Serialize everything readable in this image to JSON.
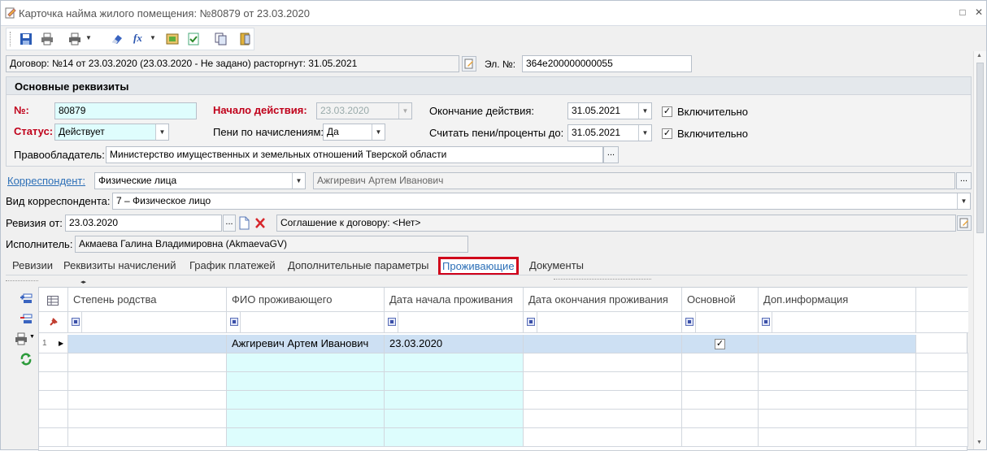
{
  "window": {
    "title": "Карточка найма жилого помещения: №80879 от 23.03.2020",
    "pin": "□",
    "close": "✕"
  },
  "toolbar": {
    "icons": [
      "save-icon",
      "print-icon",
      "print-dropdown-icon",
      "eraser-icon",
      "formula-icon",
      "book-green-icon",
      "doc-check-icon",
      "copy-icon",
      "exit-icon"
    ]
  },
  "contract": {
    "text": "Договор: №14 от 23.03.2020 (23.03.2020 -  Не задано) расторгнут: 31.05.2021",
    "el_label": "Эл. №:",
    "el_value": "364e200000000055"
  },
  "main": {
    "header": "Основные реквизиты",
    "num_label": "№:",
    "num_value": "80879",
    "start_label": "Начало действия:",
    "start_value": "23.03.2020",
    "end_label": "Окончание действия:",
    "end_value": "31.05.2021",
    "end_incl": "Включительно",
    "status_label": "Статус:",
    "status_value": "Действует",
    "peni_label": "Пени по начислениям:",
    "peni_value": "Да",
    "calc_label": "Считать пени/проценты до:",
    "calc_value": "31.05.2021",
    "calc_incl": "Включительно",
    "owner_label": "Правообладатель:",
    "owner_value": "Министерство имущественных и земельных отношений Тверской области"
  },
  "corr": {
    "label": "Корреспондент:",
    "type": "Физические лица",
    "name": "Ажгиревич Артем Иванович"
  },
  "kind": {
    "label": "Вид корреспондента:",
    "value": "7 – Физическое лицо"
  },
  "revision": {
    "label": "Ревизия от:",
    "value": "23.03.2020",
    "agreement": "Соглашение к договору: <Нет>"
  },
  "executor": {
    "label": "Исполнитель:",
    "value": "Акмаева Галина Владимировна (AkmaevaGV)"
  },
  "tabs": [
    "Ревизии",
    "Реквизиты начислений",
    "График платежей",
    "Дополнительные параметры",
    "Проживающие",
    "Документы"
  ],
  "grid": {
    "columns": [
      "Степень родства",
      "ФИО проживающего",
      "Дата начала проживания",
      "Дата окончания проживания",
      "Основной",
      "Доп.информация"
    ],
    "rows": [
      {
        "num": "1",
        "relation": "",
        "fio": "Ажгиревич Артем Иванович",
        "start": "23.03.2020",
        "end": "",
        "main": "✓",
        "info": ""
      }
    ]
  },
  "colors": {
    "accent": "#2c6fb7",
    "required": "#c0001a",
    "highlight": "#d0001a",
    "cyan": "#dffdfd",
    "selected": "#cde0f3"
  }
}
